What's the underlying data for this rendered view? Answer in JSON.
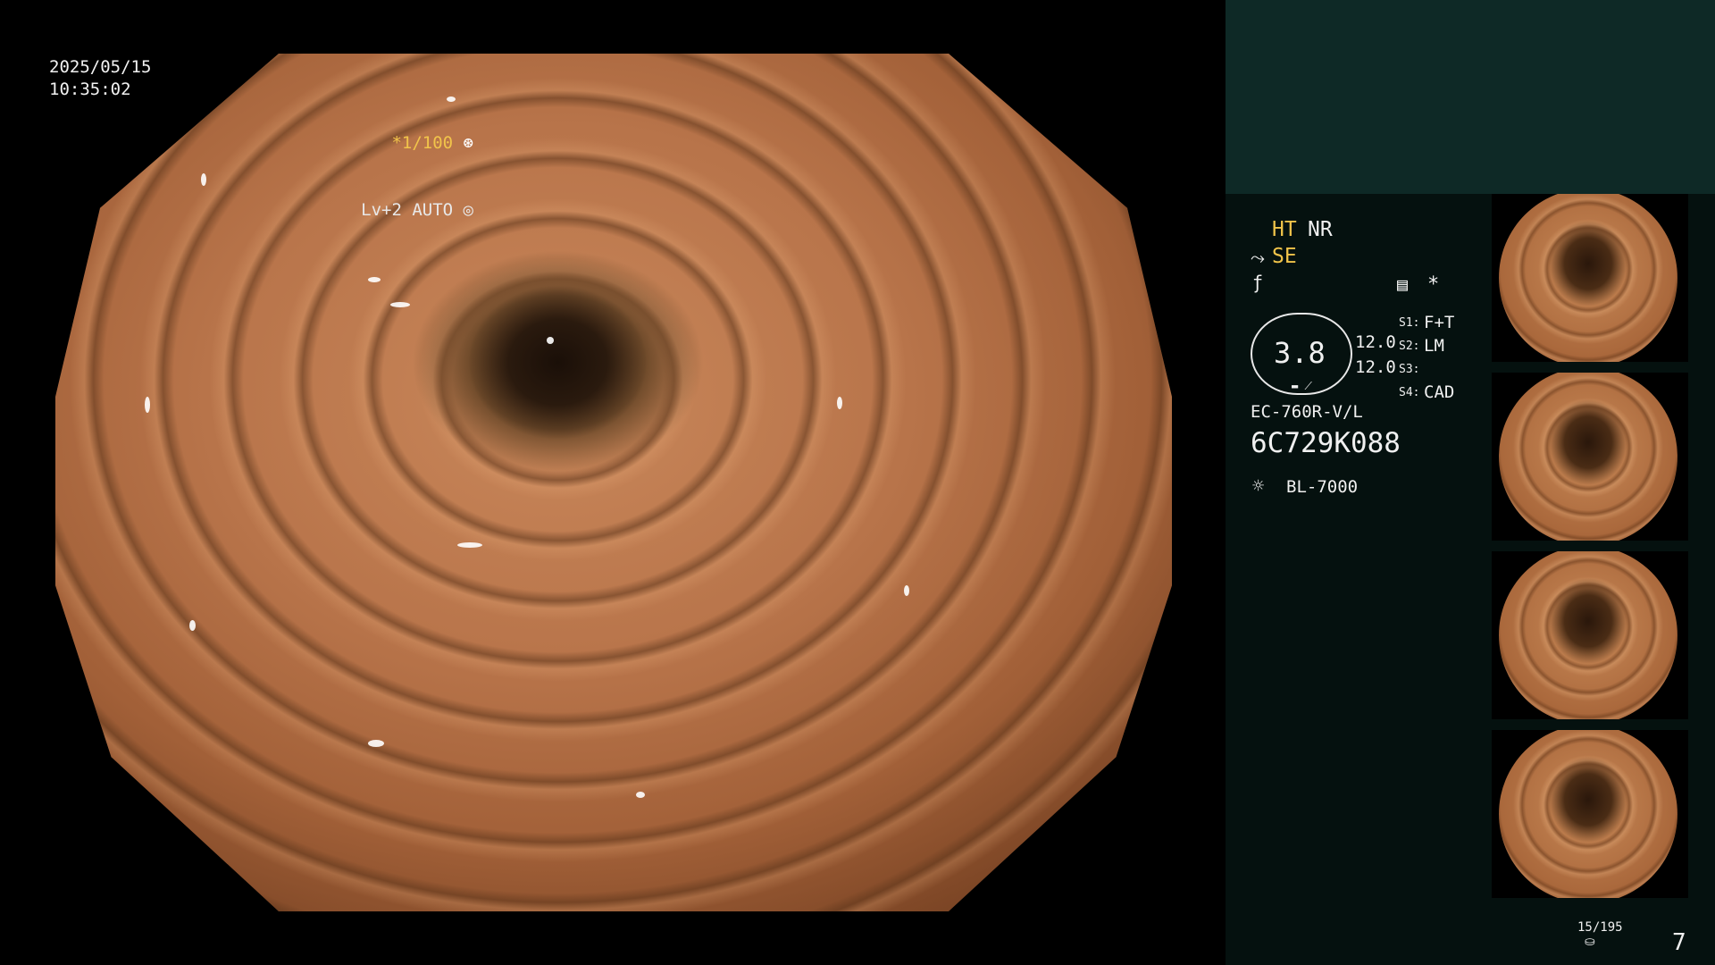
{
  "overlay": {
    "date": "2025/05/15",
    "time": "10:35:02",
    "shutter": "*1/100",
    "level": "Lv+2 AUTO"
  },
  "panel": {
    "ht": "HT",
    "nr": "NR",
    "se": "SE",
    "asterisk": "*",
    "gauge_value": "3.8",
    "val_a": "12.0",
    "val_b": "12.0",
    "s1_key": "S1:",
    "s1_val": "F+T",
    "s2_key": "S2:",
    "s2_val": "LM",
    "s3_key": "S3:",
    "s3_val": "",
    "s4_key": "S4:",
    "s4_val": "CAD",
    "scope_model": "EC-760R-V/L",
    "serial": "6C729K088",
    "light_source": "BL-7000",
    "counter": "15/195",
    "page_number": "7"
  },
  "icons": {
    "shutter_icon": "aperture-icon",
    "level_icon": "auto-exposure-icon",
    "se_icon": "structure-enhancement-icon",
    "color_icon": "color-tone-icon",
    "memory_icon": "image-memory-icon",
    "lamp_icon": "lamp-icon",
    "storage_icon": "storage-icon"
  },
  "colors": {
    "panel_bg": "#05110f",
    "panel_top": "#0e2926",
    "accent_yellow": "#f1c44a"
  }
}
